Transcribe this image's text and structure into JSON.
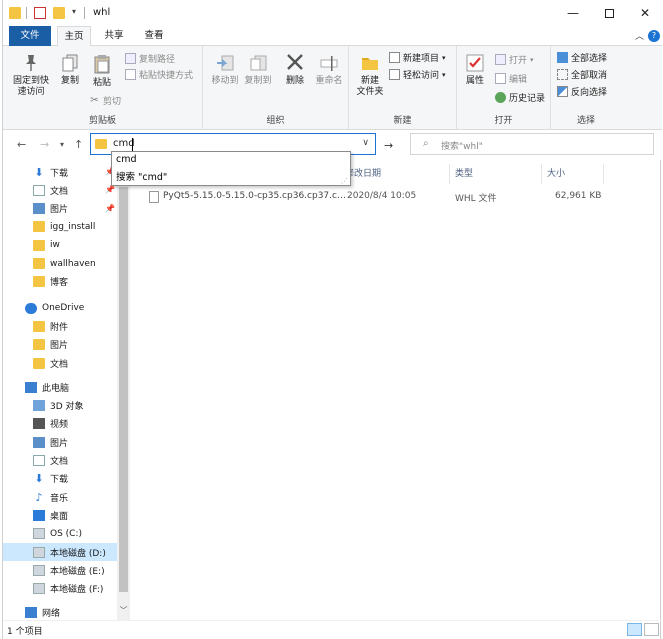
{
  "window": {
    "title": "whl"
  },
  "ribbon_tabs": [
    "文件",
    "主页",
    "共享",
    "查看"
  ],
  "ribbon": {
    "clipboard": {
      "pin": "固定到快\n速访问",
      "copy": "复制",
      "paste": "粘贴",
      "copy_path": "复制路径",
      "paste_shortcut": "粘贴快捷方式",
      "cut": "剪切",
      "label": "剪贴板"
    },
    "organize": {
      "move_to": "移动到",
      "copy_to": "复制到",
      "delete": "删除",
      "rename": "重命名",
      "label": "组织"
    },
    "new": {
      "new_item": "新建项目",
      "easy_access": "轻松访问",
      "new_folder": "新建\n文件夹",
      "label": "新建"
    },
    "open": {
      "properties": "属性",
      "open": "打开",
      "edit": "编辑",
      "history": "历史记录",
      "label": "打开"
    },
    "select": {
      "select_all": "全部选择",
      "select_none": "全部取消",
      "invert": "反向选择",
      "label": "选择"
    }
  },
  "address": {
    "value": "cmd"
  },
  "search": {
    "placeholder": "搜索\"whl\""
  },
  "autocomplete": [
    "cmd",
    "搜索 \"cmd\""
  ],
  "nav": {
    "quick_access": [
      {
        "label": "下载",
        "icon": "download-icon",
        "pinned": true
      },
      {
        "label": "文档",
        "icon": "document-icon",
        "pinned": true
      },
      {
        "label": "图片",
        "icon": "picture-icon",
        "pinned": true
      },
      {
        "label": "igg_install",
        "icon": "folder-icon",
        "pinned": false
      },
      {
        "label": "iw",
        "icon": "folder-icon",
        "pinned": false
      },
      {
        "label": "wallhaven",
        "icon": "folder-icon",
        "pinned": false
      },
      {
        "label": "博客",
        "icon": "folder-icon",
        "pinned": false
      }
    ],
    "onedrive": {
      "label": "OneDrive",
      "children": [
        "附件",
        "图片",
        "文档"
      ]
    },
    "this_pc": {
      "label": "此电脑",
      "children": [
        {
          "label": "3D 对象",
          "icon": "3d-objects-icon"
        },
        {
          "label": "视频",
          "icon": "video-icon"
        },
        {
          "label": "图片",
          "icon": "picture-icon"
        },
        {
          "label": "文档",
          "icon": "document-icon"
        },
        {
          "label": "下载",
          "icon": "download-icon"
        },
        {
          "label": "音乐",
          "icon": "music-icon"
        },
        {
          "label": "桌面",
          "icon": "desktop-icon"
        },
        {
          "label": "OS (C:)",
          "icon": "os-drive-icon"
        },
        {
          "label": "本地磁盘 (D:)",
          "icon": "drive-icon",
          "selected": true
        },
        {
          "label": "本地磁盘 (E:)",
          "icon": "drive-icon"
        },
        {
          "label": "本地磁盘 (F:)",
          "icon": "drive-icon"
        }
      ]
    },
    "network": "网络"
  },
  "columns": [
    "修改日期",
    "类型",
    "大小"
  ],
  "files": [
    {
      "name": "PyQt5-5.15.0-5.15.0-cp35.cp36.cp37.c…",
      "modified": "2020/8/4 10:05",
      "type": "WHL 文件",
      "size": "62,961 KB"
    }
  ],
  "status": {
    "count": "1 个项目"
  },
  "colors": {
    "accent": "#1a5ea6",
    "selection": "#cce8ff",
    "folder": "#f4c542"
  }
}
